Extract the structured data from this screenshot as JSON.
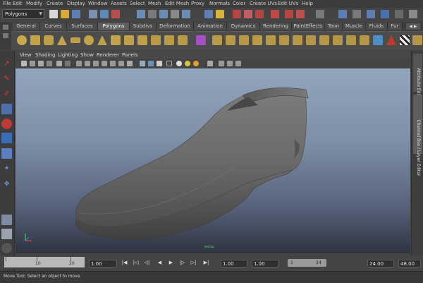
{
  "menubar": [
    "File",
    "Edit",
    "Modify",
    "Create",
    "Display",
    "Window",
    "Assets",
    "Select",
    "Mesh",
    "Edit Mesh",
    "Proxy",
    "Normals",
    "Color",
    "Create UVs",
    "Edit UVs",
    "Help"
  ],
  "mode_selector": {
    "value": "Polygons"
  },
  "shelf_tabs": [
    "General",
    "Curves",
    "Surfaces",
    "Polygons",
    "Subdivs",
    "Deformation",
    "Animation",
    "Dynamics",
    "Rendering",
    "PaintEffects",
    "Toon",
    "Muscle",
    "Fluids",
    "Fur"
  ],
  "active_shelf_tab": "Polygons",
  "panel_menu": [
    "View",
    "Shading",
    "Lighting",
    "Show",
    "Renderer",
    "Panels"
  ],
  "right_tabs": {
    "attribute_editor": "Attribute Editor",
    "channel_box": "Channel Box / Layer Editor"
  },
  "viewport": {
    "camera_label": "persp"
  },
  "timeline": {
    "ruler_labels": [
      "10",
      "20"
    ],
    "current_time": "1.00",
    "start_time": "1.00",
    "range_start": "1.00",
    "range_bar_start": "1",
    "range_bar_end": "24",
    "end_time": "24.00",
    "anim_end": "48.00"
  },
  "help_line": {
    "text": "Move Tool: Select an object to move."
  },
  "colors": {
    "accent_red": "#c0392b",
    "viewport_top": "#93a5bd",
    "viewport_bottom": "#2e333f",
    "shoe": "#6f6f6f"
  }
}
